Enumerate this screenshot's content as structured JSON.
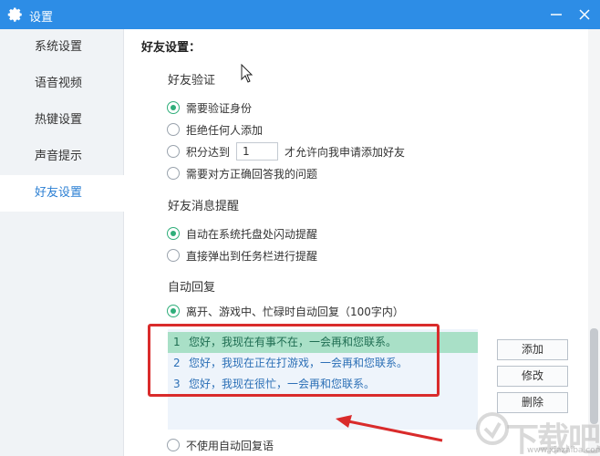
{
  "window": {
    "title": "设置",
    "icon": "gear-icon",
    "minimize_icon": "minimize-icon",
    "close_icon": "close-icon"
  },
  "sidebar": {
    "items": [
      {
        "label": "系统设置",
        "active": false
      },
      {
        "label": "语音视频",
        "active": false
      },
      {
        "label": "热键设置",
        "active": false
      },
      {
        "label": "声音提示",
        "active": false
      },
      {
        "label": "好友设置",
        "active": true
      }
    ]
  },
  "main": {
    "section_title": "好友设置：",
    "verification": {
      "title": "好友验证",
      "options": [
        {
          "label": "需要验证身份",
          "checked": true
        },
        {
          "label": "拒绝任何人添加",
          "checked": false
        },
        {
          "label": "积分达到",
          "checked": false,
          "input_value": "1",
          "suffix": "才允许向我申请添加好友"
        },
        {
          "label": "需要对方正确回答我的问题",
          "checked": false
        }
      ]
    },
    "message_reminder": {
      "title": "好友消息提醒",
      "options": [
        {
          "label": "自动在系统托盘处闪动提醒",
          "checked": true
        },
        {
          "label": "直接弹出到任务栏进行提醒",
          "checked": false
        }
      ]
    },
    "auto_reply": {
      "title": "自动回复",
      "enable_option": {
        "label": "离开、游戏中、忙碌时自动回复（100字内）",
        "checked": true
      },
      "replies": [
        {
          "num": "1",
          "text": "您好，我现在有事不在，一会再和您联系。",
          "selected": true
        },
        {
          "num": "2",
          "text": "您好，我现在正在打游戏，一会再和您联系。",
          "selected": false
        },
        {
          "num": "3",
          "text": "您好，我现在很忙，一会再和您联系。",
          "selected": false
        }
      ],
      "buttons": {
        "add": "添加",
        "edit": "修改",
        "delete": "删除"
      },
      "disable_option": {
        "label": "不使用自动回复语",
        "checked": false
      }
    }
  },
  "watermark": {
    "text": "下载吧",
    "sub": "www.xiazaiba.com"
  },
  "colors": {
    "titlebar": "#2d8de6",
    "accent_green": "#2fae7a",
    "selected_row": "#a9e0c7",
    "annotation_red": "#d92b2b"
  }
}
